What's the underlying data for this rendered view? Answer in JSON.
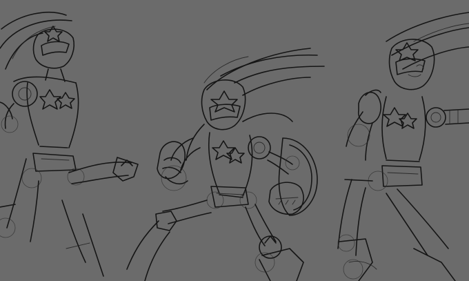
{
  "artwork": {
    "background_color": "#6b6b6b",
    "line_color": "#151515",
    "figures": [
      {
        "name": "left-figure"
      },
      {
        "name": "center-figure"
      },
      {
        "name": "right-figure"
      }
    ]
  }
}
